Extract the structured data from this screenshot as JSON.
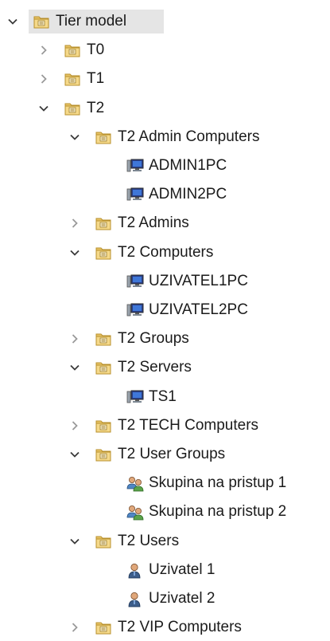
{
  "tree": {
    "nodes": [
      {
        "id": "tier-model",
        "label": "Tier model",
        "level": 0,
        "icon": "folder",
        "expander": "expanded",
        "selected": true
      },
      {
        "id": "t0",
        "label": "T0",
        "level": 1,
        "icon": "folder",
        "expander": "collapsed"
      },
      {
        "id": "t1",
        "label": "T1",
        "level": 1,
        "icon": "folder",
        "expander": "collapsed"
      },
      {
        "id": "t2",
        "label": "T2",
        "level": 1,
        "icon": "folder",
        "expander": "expanded"
      },
      {
        "id": "t2-admin-computers",
        "label": "T2 Admin Computers",
        "level": 2,
        "icon": "folder",
        "expander": "expanded"
      },
      {
        "id": "admin1pc",
        "label": "ADMIN1PC",
        "level": 3,
        "icon": "computer",
        "expander": "none"
      },
      {
        "id": "admin2pc",
        "label": "ADMIN2PC",
        "level": 3,
        "icon": "computer",
        "expander": "none"
      },
      {
        "id": "t2-admins",
        "label": "T2 Admins",
        "level": 2,
        "icon": "folder",
        "expander": "collapsed"
      },
      {
        "id": "t2-computers",
        "label": "T2 Computers",
        "level": 2,
        "icon": "folder",
        "expander": "expanded"
      },
      {
        "id": "uzivatel1pc",
        "label": "UZIVATEL1PC",
        "level": 3,
        "icon": "computer",
        "expander": "none"
      },
      {
        "id": "uzivatel2pc",
        "label": "UZIVATEL2PC",
        "level": 3,
        "icon": "computer",
        "expander": "none"
      },
      {
        "id": "t2-groups",
        "label": "T2 Groups",
        "level": 2,
        "icon": "folder",
        "expander": "collapsed"
      },
      {
        "id": "t2-servers",
        "label": "T2 Servers",
        "level": 2,
        "icon": "folder",
        "expander": "expanded"
      },
      {
        "id": "ts1",
        "label": "TS1",
        "level": 3,
        "icon": "computer",
        "expander": "none"
      },
      {
        "id": "t2-tech-computers",
        "label": "T2 TECH Computers",
        "level": 2,
        "icon": "folder",
        "expander": "collapsed"
      },
      {
        "id": "t2-user-groups",
        "label": "T2 User Groups",
        "level": 2,
        "icon": "folder",
        "expander": "expanded"
      },
      {
        "id": "skupina-1",
        "label": "Skupina na pristup 1",
        "level": 3,
        "icon": "group",
        "expander": "none"
      },
      {
        "id": "skupina-2",
        "label": "Skupina na pristup 2",
        "level": 3,
        "icon": "group",
        "expander": "none"
      },
      {
        "id": "t2-users",
        "label": "T2 Users",
        "level": 2,
        "icon": "folder",
        "expander": "expanded"
      },
      {
        "id": "uzivatel-1",
        "label": "Uzivatel 1",
        "level": 3,
        "icon": "user",
        "expander": "none"
      },
      {
        "id": "uzivatel-2",
        "label": "Uzivatel 2",
        "level": 3,
        "icon": "user",
        "expander": "none"
      },
      {
        "id": "t2-vip-computers",
        "label": "T2 VIP Computers",
        "level": 2,
        "icon": "folder",
        "expander": "collapsed"
      }
    ]
  }
}
